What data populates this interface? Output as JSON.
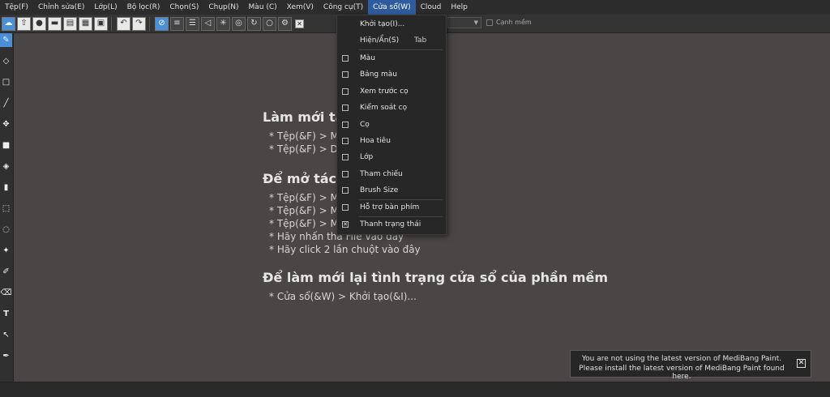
{
  "menubar": {
    "items": [
      "Tệp(F)",
      "Chỉnh sửa(E)",
      "Lớp(L)",
      "Bộ lọc(R)",
      "Chọn(S)",
      "Chụp(N)",
      "Màu (C)",
      "Xem(V)",
      "Công cụ(T)",
      "Cửa sổ(W)",
      "Cloud",
      "Help"
    ],
    "active": "Cửa sổ(W)"
  },
  "toolbar": {
    "smooth_label": "Cạnh mềm",
    "x_mark": "✕"
  },
  "welcome": {
    "sec1_title": "Làm mới tá",
    "sec1_lines": [
      "* Tệp(&F) > M",
      "* Tệp(&F) > D"
    ],
    "sec2_title": "Để mở tác",
    "sec2_lines": [
      "* Tệp(&F) > M",
      "* Tệp(&F) > M",
      "* Tệp(&F) > M",
      "* Hãy nhấn thả File vào đây",
      "* Hãy click 2 lần chuột vào đây"
    ],
    "sec3_title": "Để làm mới lại tình trạng cửa sổ của phần mềm",
    "sec3_lines": [
      "* Cửa sổ(&W) > Khởi tạo(&I)..."
    ]
  },
  "window_menu": {
    "items": [
      {
        "label": "Khởi tạo(I)...",
        "shortcut": "",
        "checkbox": false,
        "checked": false
      },
      {
        "label": "Hiện/Ẩn(S)",
        "shortcut": "Tab",
        "checkbox": false,
        "checked": false
      },
      {
        "label": "Màu",
        "shortcut": "",
        "checkbox": true,
        "checked": false
      },
      {
        "label": "Bảng màu",
        "shortcut": "",
        "checkbox": true,
        "checked": false
      },
      {
        "label": "Xem trước cọ",
        "shortcut": "",
        "checkbox": true,
        "checked": false
      },
      {
        "label": "Kiểm soát cọ",
        "shortcut": "",
        "checkbox": true,
        "checked": false
      },
      {
        "label": "Cọ",
        "shortcut": "",
        "checkbox": true,
        "checked": false
      },
      {
        "label": "Hoa tiêu",
        "shortcut": "",
        "checkbox": true,
        "checked": false
      },
      {
        "label": "Lớp",
        "shortcut": "",
        "checkbox": true,
        "checked": false
      },
      {
        "label": "Tham chiếu",
        "shortcut": "",
        "checkbox": true,
        "checked": false
      },
      {
        "label": "Brush Size",
        "shortcut": "",
        "checkbox": true,
        "checked": false
      },
      {
        "label": "Hỗ trợ bàn phím",
        "shortcut": "",
        "checkbox": true,
        "checked": false
      },
      {
        "label": "Thanh trạng thái",
        "shortcut": "",
        "checkbox": true,
        "checked": true
      }
    ]
  },
  "notice": {
    "line1": "You are not using the latest version of MediBang Paint.",
    "line2": "Please install the latest version of MediBang Paint found here.",
    "close": "✕"
  },
  "colors": {
    "accent": "#4a90d9",
    "menu_active": "#2f5c9e",
    "canvas_bg": "#4a4646"
  }
}
